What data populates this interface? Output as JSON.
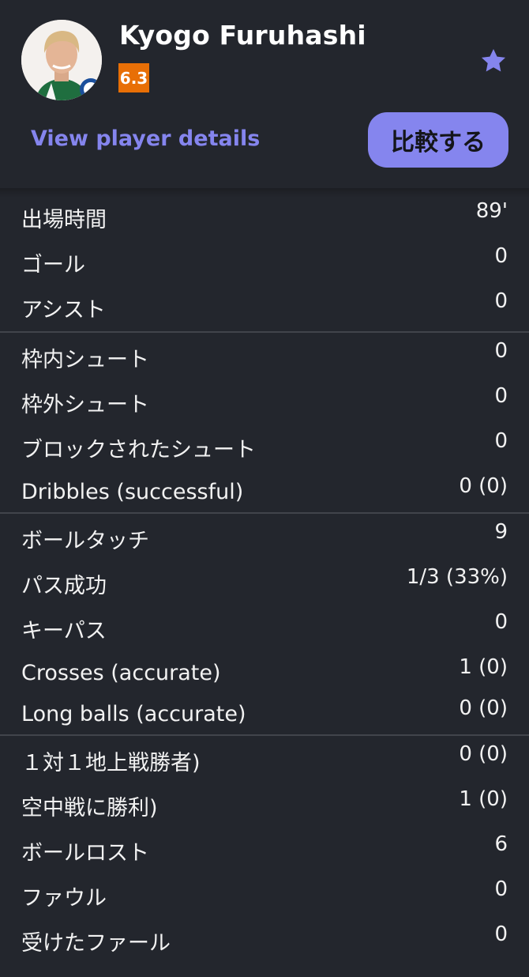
{
  "player": {
    "name": "Kyogo Furuhashi",
    "rating": "6.3",
    "rating_color": "#e86f06",
    "view_details": "View player details",
    "compare_label": "比較する",
    "accent_color": "#8585ee",
    "favorite_icon": "star-icon"
  },
  "stats": {
    "group1": [
      {
        "label": "出場時間",
        "value": "89'"
      },
      {
        "label": "ゴール",
        "value": "0"
      },
      {
        "label": "アシスト",
        "value": "0"
      }
    ],
    "group2": [
      {
        "label": "枠内シュート",
        "value": "0"
      },
      {
        "label": "枠外シュート",
        "value": "0"
      },
      {
        "label": "ブロックされたシュート",
        "value": "0"
      },
      {
        "label": "Dribbles (successful)",
        "value": "0 (0)"
      }
    ],
    "group3": [
      {
        "label": "ボールタッチ",
        "value": "9"
      },
      {
        "label": "パス成功",
        "value": "1/3 (33%)"
      },
      {
        "label": "キーパス",
        "value": "0"
      },
      {
        "label": "Crosses (accurate)",
        "value": "1 (0)"
      },
      {
        "label": "Long balls (accurate)",
        "value": "0 (0)"
      }
    ],
    "group4": [
      {
        "label": "１対１地上戦勝者)",
        "value": "0 (0)"
      },
      {
        "label": "空中戦に勝利)",
        "value": "1 (0)"
      },
      {
        "label": "ボールロスト",
        "value": "6"
      },
      {
        "label": "ファウル",
        "value": "0"
      },
      {
        "label": "受けたファール",
        "value": "0"
      }
    ]
  }
}
